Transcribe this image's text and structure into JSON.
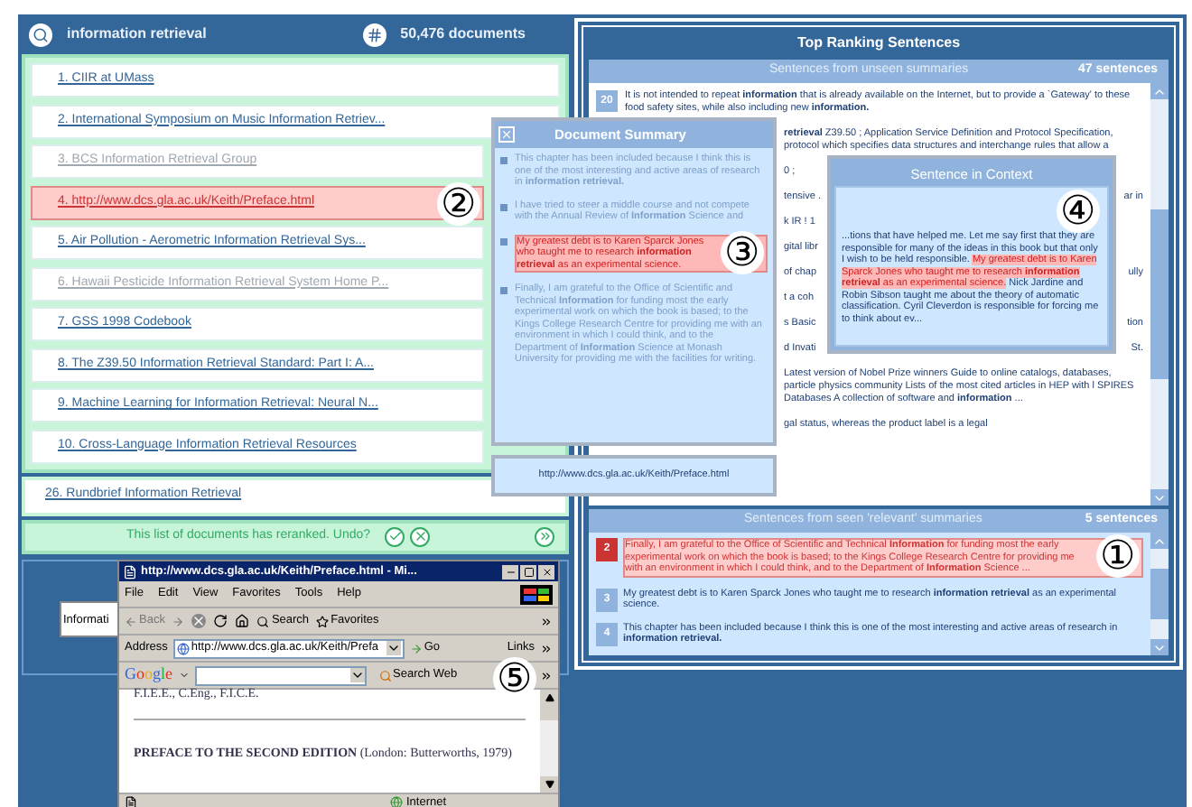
{
  "search": {
    "query": "information retrieval",
    "count": "50,476 documents"
  },
  "results": [
    {
      "label": "1. CIIR at UMass",
      "visited": false,
      "selected": false
    },
    {
      "label": "2. International Symposium on Music Information Retriev...",
      "visited": false,
      "selected": false
    },
    {
      "label": "3. BCS Information Retrieval Group",
      "visited": true,
      "selected": false
    },
    {
      "label": "4. http://www.dcs.gla.ac.uk/Keith/Preface.html",
      "visited": false,
      "selected": true,
      "callout": "②"
    },
    {
      "label": "5. Air Pollution - Aerometric Information Retrieval Sys...",
      "visited": false,
      "selected": false
    },
    {
      "label": "6. Hawaii Pesticide Information Retrieval System Home P...",
      "visited": true,
      "selected": false
    },
    {
      "label": "7. GSS 1998 Codebook",
      "visited": false,
      "selected": false
    },
    {
      "label": "8. The Z39.50 Information Retrieval Standard: Part I: A...",
      "visited": false,
      "selected": false
    },
    {
      "label": "9. Machine Learning for Information Retrieval: Neural N...",
      "visited": false,
      "selected": false
    },
    {
      "label": "10. Cross-Language Information Retrieval Resources",
      "visited": false,
      "selected": false
    }
  ],
  "extra_result": {
    "label": "26. Rundbrief Information Retrieval"
  },
  "rerank_bar": {
    "message": "This list of documents has reranked. Undo?"
  },
  "query_field": {
    "value": "Informati"
  },
  "sentences_panel": {
    "title": "Top Ranking Sentences",
    "unseen": {
      "heading": "Sentences from unseen summaries",
      "count": "47 sentences",
      "rows": [
        {
          "kind": "full",
          "number": "20",
          "text": "It is not intended to repeat **information** that is already available on the Internet, but to provide a `Gateway' to these food safety sites, while also including new **information.**"
        },
        {
          "kind": "fragment",
          "text": "**retrieval** Z39.50 ; Application Service Definition and Protocol Specification, protocol which specifies data structures and interchange rules that allow a"
        },
        {
          "kind": "fragment",
          "text": "0 ;"
        },
        {
          "kind": "fragment",
          "text": "tensive .",
          "right": "ar in"
        },
        {
          "kind": "fragment",
          "text": "k IR ! 1"
        },
        {
          "kind": "fragment",
          "text": "gital libr"
        },
        {
          "kind": "fragment",
          "text": "of chap",
          "right": "ully"
        },
        {
          "kind": "fragment",
          "text": "t a coh"
        },
        {
          "kind": "fragment",
          "text": "s Basic",
          "right": "tion"
        },
        {
          "kind": "fragment",
          "text": "d Invati",
          "right": "St."
        },
        {
          "kind": "fragment",
          "text": "Latest version of Nobel Prize winners Guide to online catalogs, databases, particle physics community Lists of the most cited articles in HEP with l SPIRES Databases A collection of software and **information** ..."
        },
        {
          "kind": "fragment",
          "text": "gal status, whereas the product label is a legal"
        }
      ]
    },
    "seen": {
      "heading": "Sentences from seen 'relevant' summaries",
      "count": "5 sentences",
      "rows": [
        {
          "number": "2",
          "selected": true,
          "callout": "①",
          "text": "Finally, I am grateful to the Office of Scientific and Technical **Information** for funding most the early experimental work on which the book is based; to the Kings College Research Centre for providing me with an environment in which I could think, and to the Department of **Information** Science ..."
        },
        {
          "number": "3",
          "selected": false,
          "text": "My greatest debt is to Karen Sparck Jones who taught me to research **information retrieval** as an experimental science."
        },
        {
          "number": "4",
          "selected": false,
          "text": "This chapter has been included because I think this is one of the most interesting and active areas of research in **information retrieval.**"
        }
      ]
    }
  },
  "summary_popup": {
    "title": "Document Summary",
    "callout": "③",
    "sentences": [
      {
        "selected": false,
        "text": "This chapter has been included because I think this is one of the most interesting and active areas of research in **information retrieval.**"
      },
      {
        "selected": false,
        "text": "I have tried to steer a middle course and not compete with the Annual Review of **Information** Science and"
      },
      {
        "selected": true,
        "text": "My greatest debt is to Karen Sparck Jones who taught me to research **information retrieval** as an experimental science."
      },
      {
        "selected": false,
        "text": "Finally, I am grateful to the Office of Scientific and Technical **Information** for funding most the early experimental work on which the book is based; to the Kings College Research Centre for providing me with an environment in which I could think, and to the Department of **Information** Science at Monash University for providing me with the facilities for writing."
      }
    ],
    "url": "http://www.dcs.gla.ac.uk/Keith/Preface.html"
  },
  "context_popup": {
    "title": "Sentence in Context",
    "callout": "④",
    "before": "...tions that have helped me. Let me say first that they are responsible for many of the ideas in this book but that only I wish to be held responsible.",
    "highlight": "My greatest debt is to Karen Sparck Jones who taught me to research **information retrieval** as an experimental science.",
    "after": "Nick Jardine and Robin Sibson taught me about the theory of automatic classification. Cyril Cleverdon is responsible for forcing me to think about ev..."
  },
  "browser": {
    "title": "http://www.dcs.gla.ac.uk/Keith/Preface.html - Mi...",
    "callout": "⑤",
    "menu": [
      "File",
      "Edit",
      "View",
      "Favorites",
      "Tools",
      "Help"
    ],
    "back": "Back",
    "search": "Search",
    "favorites": "Favorites",
    "address_label": "Address",
    "address": "http://www.dcs.gla.ac.uk/Keith/Prefa",
    "go": "Go",
    "links": "Links",
    "google": "Google",
    "search_web": "Search Web",
    "content_top": "F.I.E.E., C.Eng., F.I.C.E.",
    "heading": "PREFACE TO THE SECOND EDITION",
    "heading_rest": "(London: Butterworths, 1979)",
    "status": "Internet"
  }
}
